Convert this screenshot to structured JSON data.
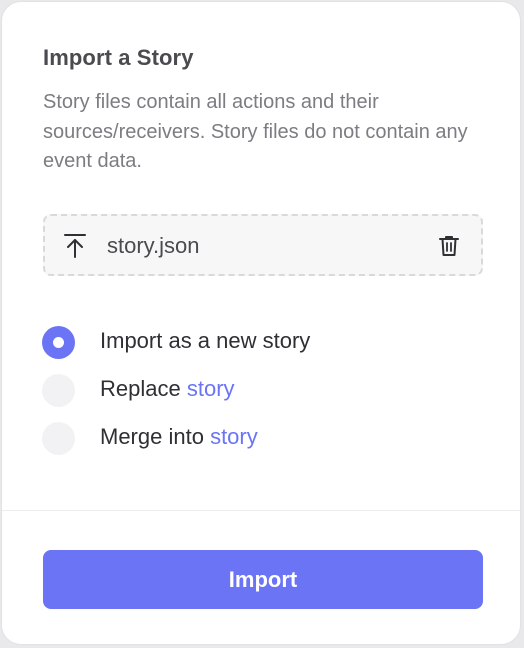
{
  "dialog": {
    "title": "Import a Story",
    "description": "Story files contain all actions and their sources/receivers. Story files do not contain any event data."
  },
  "file": {
    "name": "story.json",
    "upload_icon": "upload-arrow-icon",
    "delete_icon": "trash-icon"
  },
  "options": [
    {
      "label": "Import as a new story",
      "link": "",
      "selected": true
    },
    {
      "label": "Replace ",
      "link": "story",
      "selected": false
    },
    {
      "label": "Merge into ",
      "link": "story",
      "selected": false
    }
  ],
  "actions": {
    "import_label": "Import"
  },
  "colors": {
    "accent": "#6a74f5",
    "title": "#4a4a4f",
    "muted": "#7c7c82"
  }
}
